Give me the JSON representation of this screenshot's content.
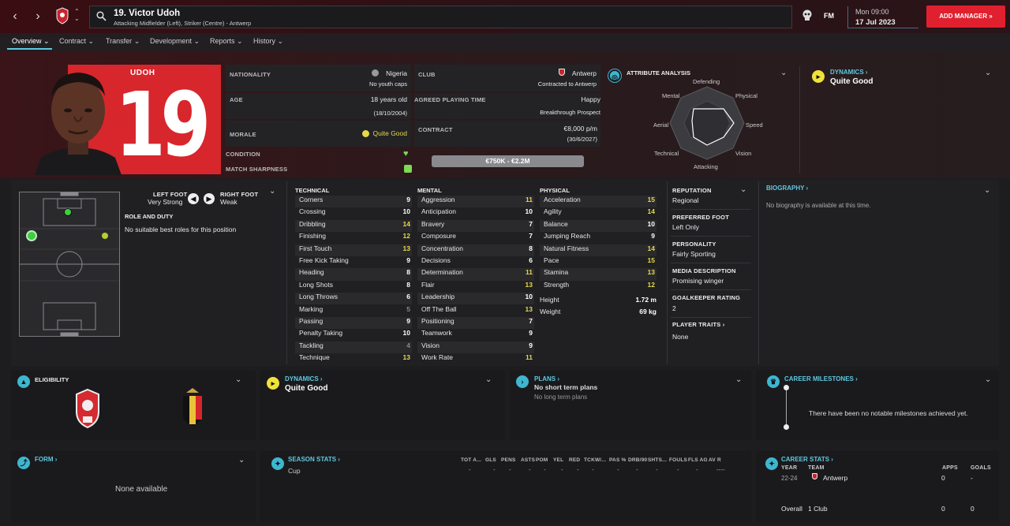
{
  "header": {
    "player_name": "19. Victor Udoh",
    "positions": "Attacking Midfielder (Left), Striker (Centre) - Antwerp",
    "fm_label": "FM",
    "time": "Mon 09:00",
    "date": "17 Jul 2023",
    "add_manager": "ADD MANAGER"
  },
  "tabs": [
    {
      "label": "Overview"
    },
    {
      "label": "Contract"
    },
    {
      "label": "Transfer"
    },
    {
      "label": "Development"
    },
    {
      "label": "Reports"
    },
    {
      "label": "History"
    }
  ],
  "profile": {
    "shirt_name": "UDOH",
    "shirt_number": "19",
    "nationality_label": "NATIONALITY",
    "nationality": "Nigeria",
    "youth_caps": "No youth caps",
    "club_label": "CLUB",
    "club": "Antwerp",
    "club_status": "Contracted to Antwerp",
    "age_label": "AGE",
    "age": "18 years old",
    "dob": "(18/10/2004)",
    "playing_time_label": "AGREED PLAYING TIME",
    "playing_mood": "Happy",
    "playing_time": "Breakthrough Prospect",
    "morale_label": "MORALE",
    "morale": "Quite Good",
    "contract_label": "CONTRACT",
    "wage": "€8,000 p/m",
    "contract_end": "(30/6/2027)",
    "condition_label": "CONDITION",
    "sharpness_label": "MATCH SHARPNESS",
    "value_range": "€750K - €2.2M"
  },
  "attribute_analysis": {
    "title": "ATTRIBUTE ANALYSIS",
    "axes": [
      "Defending",
      "Physical",
      "Speed",
      "Vision",
      "Attacking",
      "Technical",
      "Aerial",
      "Mental"
    ]
  },
  "dynamics_top": {
    "title": "DYNAMICS",
    "value": "Quite Good"
  },
  "feet": {
    "left_label": "LEFT FOOT",
    "left_value": "Very Strong",
    "right_label": "RIGHT FOOT",
    "right_value": "Weak"
  },
  "role": {
    "title": "ROLE AND DUTY",
    "text": "No suitable best roles for this position"
  },
  "attributes": {
    "technical_title": "TECHNICAL",
    "mental_title": "MENTAL",
    "physical_title": "PHYSICAL",
    "technical": [
      {
        "name": "Corners",
        "value": "9"
      },
      {
        "name": "Crossing",
        "value": "10"
      },
      {
        "name": "Dribbling",
        "value": "14"
      },
      {
        "name": "Finishing",
        "value": "12"
      },
      {
        "name": "First Touch",
        "value": "13"
      },
      {
        "name": "Free Kick Taking",
        "value": "9"
      },
      {
        "name": "Heading",
        "value": "8"
      },
      {
        "name": "Long Shots",
        "value": "8"
      },
      {
        "name": "Long Throws",
        "value": "6"
      },
      {
        "name": "Marking",
        "value": "5"
      },
      {
        "name": "Passing",
        "value": "9"
      },
      {
        "name": "Penalty Taking",
        "value": "10"
      },
      {
        "name": "Tackling",
        "value": "4"
      },
      {
        "name": "Technique",
        "value": "13"
      }
    ],
    "mental": [
      {
        "name": "Aggression",
        "value": "11"
      },
      {
        "name": "Anticipation",
        "value": "10"
      },
      {
        "name": "Bravery",
        "value": "7"
      },
      {
        "name": "Composure",
        "value": "7"
      },
      {
        "name": "Concentration",
        "value": "8"
      },
      {
        "name": "Decisions",
        "value": "6"
      },
      {
        "name": "Determination",
        "value": "11"
      },
      {
        "name": "Flair",
        "value": "13"
      },
      {
        "name": "Leadership",
        "value": "10"
      },
      {
        "name": "Off The Ball",
        "value": "13"
      },
      {
        "name": "Positioning",
        "value": "7"
      },
      {
        "name": "Teamwork",
        "value": "9"
      },
      {
        "name": "Vision",
        "value": "9"
      },
      {
        "name": "Work Rate",
        "value": "11"
      }
    ],
    "physical": [
      {
        "name": "Acceleration",
        "value": "15"
      },
      {
        "name": "Agility",
        "value": "14"
      },
      {
        "name": "Balance",
        "value": "10"
      },
      {
        "name": "Jumping Reach",
        "value": "9"
      },
      {
        "name": "Natural Fitness",
        "value": "14"
      },
      {
        "name": "Pace",
        "value": "15"
      },
      {
        "name": "Stamina",
        "value": "13"
      },
      {
        "name": "Strength",
        "value": "12"
      }
    ],
    "height_label": "Height",
    "height": "1.72 m",
    "weight_label": "Weight",
    "weight": "69 kg"
  },
  "info": {
    "reputation_label": "REPUTATION",
    "reputation": "Regional",
    "foot_label": "PREFERRED FOOT",
    "foot": "Left Only",
    "personality_label": "PERSONALITY",
    "personality": "Fairly Sporting",
    "media_label": "MEDIA DESCRIPTION",
    "media": "Promising winger",
    "gk_label": "GOALKEEPER RATING",
    "gk": "2",
    "traits_label": "PLAYER TRAITS",
    "traits": "None"
  },
  "biography": {
    "title": "BIOGRAPHY",
    "text": "No biography is available at this time."
  },
  "eligibility": {
    "title": "ELIGIBILITY"
  },
  "dynamics_bottom": {
    "title": "DYNAMICS",
    "value": "Quite Good"
  },
  "plans": {
    "title": "PLANS",
    "short": "No short term plans",
    "long": "No long term plans"
  },
  "milestones": {
    "title": "CAREER MILESTONES",
    "text": "There have been no notable milestones achieved yet."
  },
  "form": {
    "title": "FORM",
    "text": "None available"
  },
  "season_stats": {
    "title": "SEASON STATS",
    "columns": [
      "TOT A...",
      "GLS",
      "PENS",
      "ASTS",
      "POM",
      "YEL",
      "RED",
      "TCKW/...",
      "PAS %",
      "DRB/90",
      "SHTS...",
      "FOULS",
      "FLS AG",
      "AV R"
    ],
    "row_label": "Cup",
    "row_values": [
      "-",
      "-",
      "-",
      "-",
      "-",
      "-",
      "-",
      "-",
      "-",
      "-",
      "-",
      "-",
      "-",
      "----"
    ]
  },
  "career_stats": {
    "title": "CAREER STATS",
    "year_label": "YEAR",
    "team_label": "TEAM",
    "apps_label": "APPS",
    "goals_label": "GOALS",
    "year": "22-24",
    "team": "Antwerp",
    "apps": "0",
    "goals": "-",
    "overall_label": "Overall",
    "overall_clubs": "1 Club",
    "overall_apps": "0",
    "overall_goals": "0"
  },
  "colors": {
    "accent": "#5fc8e0",
    "highlight": "#e6d94a",
    "brand": "#e0202f",
    "shirt": "#d7262c"
  }
}
